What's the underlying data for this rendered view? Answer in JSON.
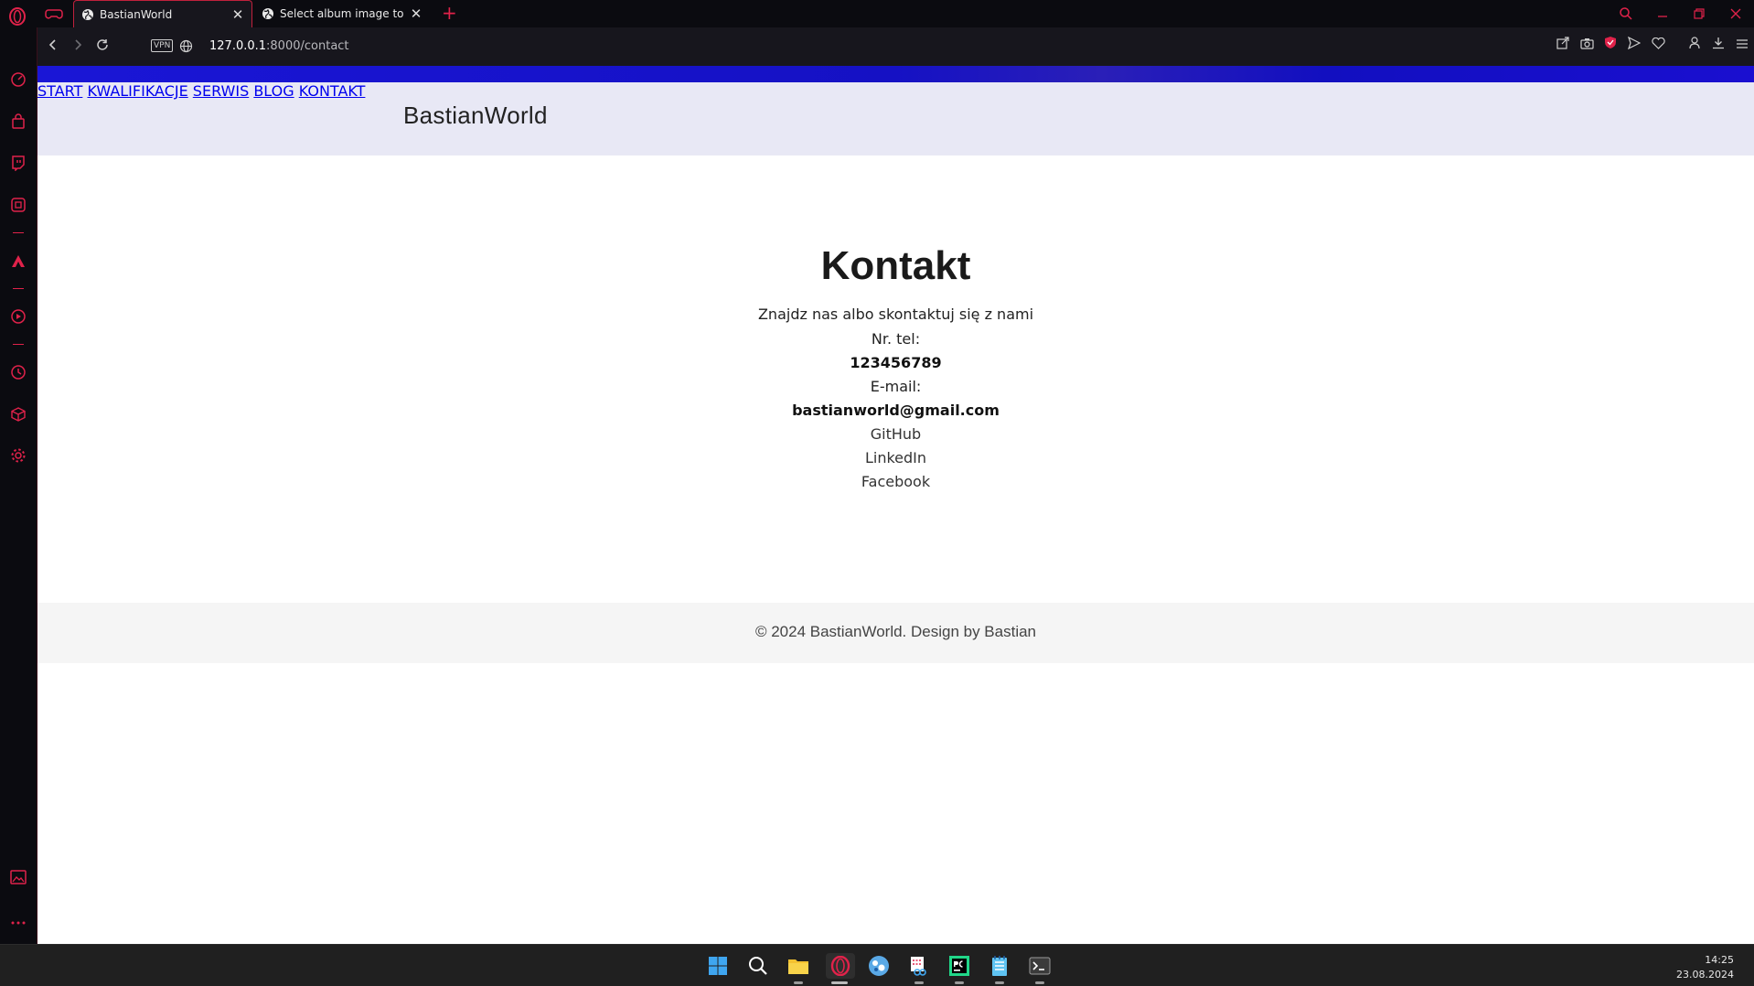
{
  "browser": {
    "tabs": [
      {
        "title": "BastianWorld",
        "active": true
      },
      {
        "title": "Select album image to cha",
        "active": false
      }
    ],
    "new_tab": "+",
    "url_host": "127.0.0.1",
    "url_path": ":8000/contact",
    "vpn_label": "VPN",
    "accent_color": "#e0224a"
  },
  "site": {
    "brand": "BastianWorld",
    "nav": [
      "START",
      "KWALIFIKACJE",
      "SERWIS",
      "BLOG",
      "KONTAKT"
    ]
  },
  "contact": {
    "heading": "Kontakt",
    "intro": "Znajdz nas albo skontaktuj się z nami",
    "phone_label": "Nr. tel:",
    "phone": "123456789",
    "email_label": "E-mail:",
    "email": "bastianworld@gmail.com",
    "links": [
      "GitHub",
      "LinkedIn",
      "Facebook"
    ]
  },
  "footer": {
    "text": "© 2024 BastianWorld. Design by Bastian"
  },
  "taskbar": {
    "time": "14:25",
    "date": "23.08.2024",
    "apps": [
      "start-icon",
      "search-icon",
      "file-explorer-icon",
      "opera-icon",
      "app-icon",
      "snipping-tool-icon",
      "pycharm-icon",
      "notepad-icon",
      "terminal-icon"
    ]
  }
}
